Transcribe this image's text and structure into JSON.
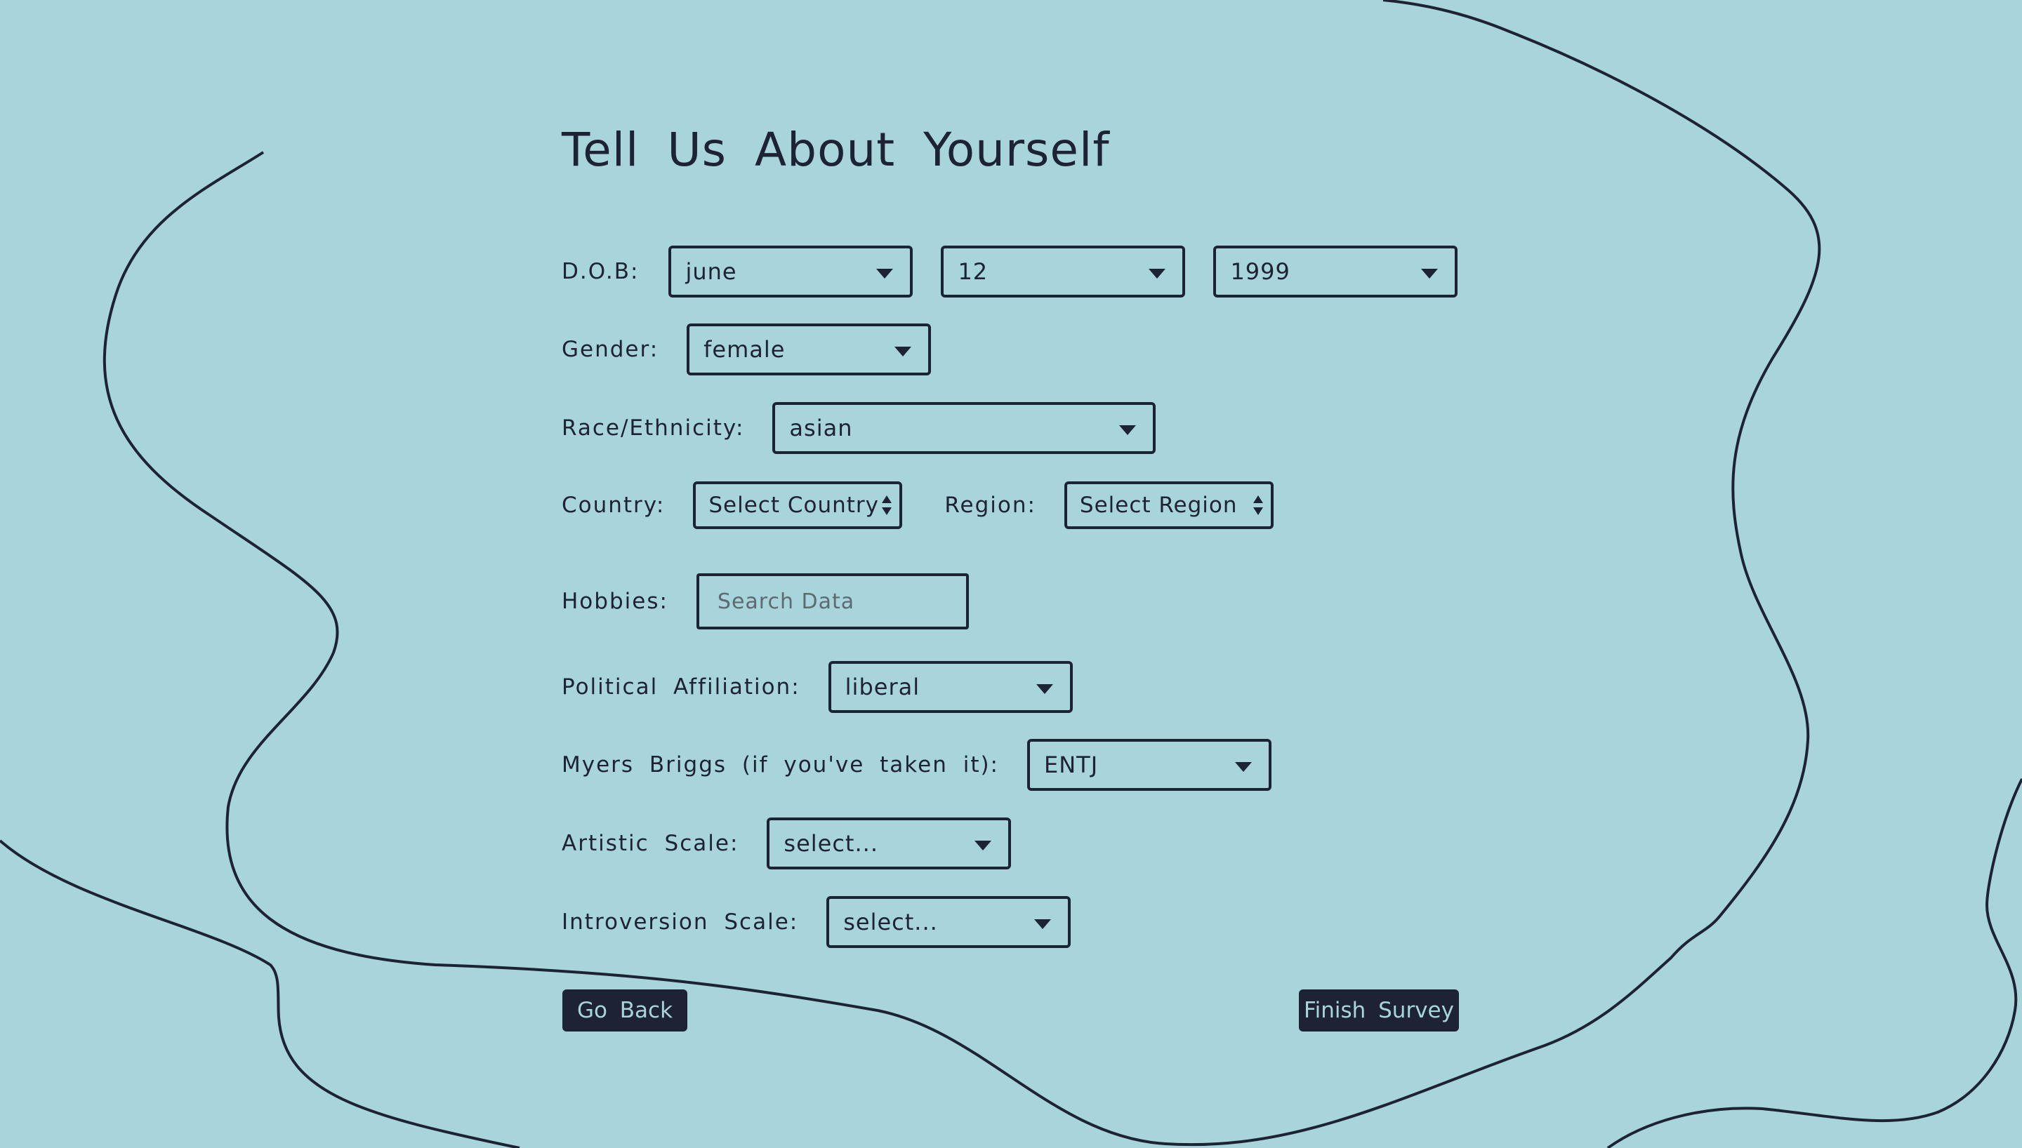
{
  "page": {
    "title": "Tell Us About Yourself"
  },
  "form": {
    "dob": {
      "label": "D.O.B:",
      "month": "june",
      "day": "12",
      "year": "1999"
    },
    "gender": {
      "label": "Gender:",
      "value": "female"
    },
    "race": {
      "label": "Race/Ethnicity:",
      "value": "asian"
    },
    "country": {
      "label": "Country:",
      "value": "Select Country"
    },
    "region": {
      "label": "Region:",
      "value": "Select Region"
    },
    "hobbies": {
      "label": "Hobbies:",
      "placeholder": "Search Data"
    },
    "political": {
      "label": "Political Affiliation:",
      "value": "liberal"
    },
    "myers_briggs": {
      "label": "Myers Briggs (if you've taken it):",
      "value": "ENTJ"
    },
    "artistic": {
      "label": "Artistic Scale:",
      "value": "select..."
    },
    "introversion": {
      "label": "Introversion Scale:",
      "value": "select..."
    }
  },
  "actions": {
    "back_label": "Go Back",
    "finish_label": "Finish Survey"
  },
  "colors": {
    "background": "#a8d4db",
    "ink": "#1e2235",
    "button_text": "#a8d4db"
  },
  "icons": {
    "dropdown": "chevron-down-icon",
    "stepper": "up-down-stepper-icon"
  }
}
